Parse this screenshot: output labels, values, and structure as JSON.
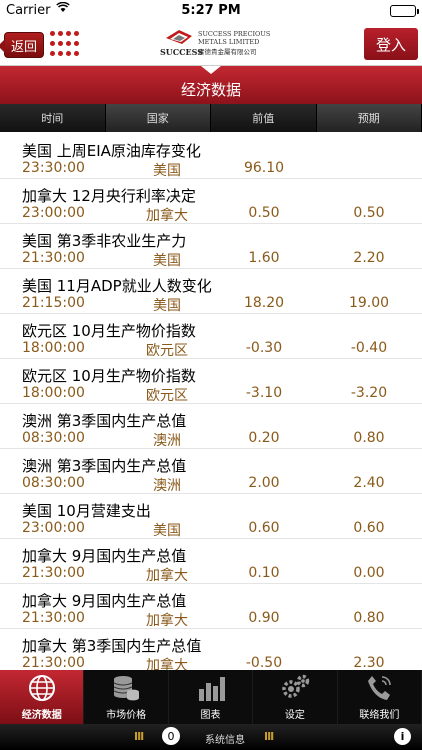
{
  "status": {
    "carrier": "Carrier",
    "time": "5:27 PM"
  },
  "header": {
    "back_label": "返回",
    "logo_brand": "SUCCESS",
    "logo_line1": "SUCCESS PRECIOUS",
    "logo_line2": "METALS LIMITED",
    "logo_line3": "實德貴金屬有限公司",
    "login_label": "登入"
  },
  "page_title": "经济数据",
  "columns": [
    "时间",
    "国家",
    "前值",
    "预期"
  ],
  "rows": [
    {
      "name": "美国 上周EIA原油库存变化",
      "time": "23:30:00",
      "country": "美国",
      "prev": "96.10",
      "forecast": ""
    },
    {
      "name": "加拿大 12月央行利率决定",
      "time": "23:00:00",
      "country": "加拿大",
      "prev": "0.50",
      "forecast": "0.50"
    },
    {
      "name": "美国 第3季非农业生产力",
      "time": "21:30:00",
      "country": "美国",
      "prev": "1.60",
      "forecast": "2.20"
    },
    {
      "name": "美国 11月ADP就业人数变化",
      "time": "21:15:00",
      "country": "美国",
      "prev": "18.20",
      "forecast": "19.00"
    },
    {
      "name": "欧元区 10月生产物价指数",
      "time": "18:00:00",
      "country": "欧元区",
      "prev": "-0.30",
      "forecast": "-0.40"
    },
    {
      "name": "欧元区 10月生产物价指数",
      "time": "18:00:00",
      "country": "欧元区",
      "prev": "-3.10",
      "forecast": "-3.20"
    },
    {
      "name": "澳洲 第3季国内生产总值",
      "time": "08:30:00",
      "country": "澳洲",
      "prev": "0.20",
      "forecast": "0.80"
    },
    {
      "name": "澳洲 第3季国内生产总值",
      "time": "08:30:00",
      "country": "澳洲",
      "prev": "2.00",
      "forecast": "2.40"
    },
    {
      "name": "美国 10月营建支出",
      "time": "23:00:00",
      "country": "美国",
      "prev": "0.60",
      "forecast": "0.60"
    },
    {
      "name": "加拿大 9月国内生产总值",
      "time": "21:30:00",
      "country": "加拿大",
      "prev": "0.10",
      "forecast": "0.00"
    },
    {
      "name": "加拿大 9月国内生产总值",
      "time": "21:30:00",
      "country": "加拿大",
      "prev": "0.90",
      "forecast": "0.80"
    },
    {
      "name": "加拿大 第3季国内生产总值",
      "time": "21:30:00",
      "country": "加拿大",
      "prev": "-0.50",
      "forecast": "2.30"
    }
  ],
  "tabs": [
    {
      "label": "经济数据",
      "icon": "globe-icon",
      "active": true
    },
    {
      "label": "市场价格",
      "icon": "coins-icon",
      "active": false
    },
    {
      "label": "图表",
      "icon": "bar-chart-icon",
      "active": false
    },
    {
      "label": "设定",
      "icon": "gears-icon",
      "active": false
    },
    {
      "label": "联络我们",
      "icon": "phone-icon",
      "active": false
    }
  ],
  "sysbar": {
    "count": "0",
    "label": "系统信息"
  },
  "colors": {
    "brand_red": "#b01e28",
    "value_brown": "#8a5a1a",
    "tabbar_bg": "#0c0c0c"
  }
}
